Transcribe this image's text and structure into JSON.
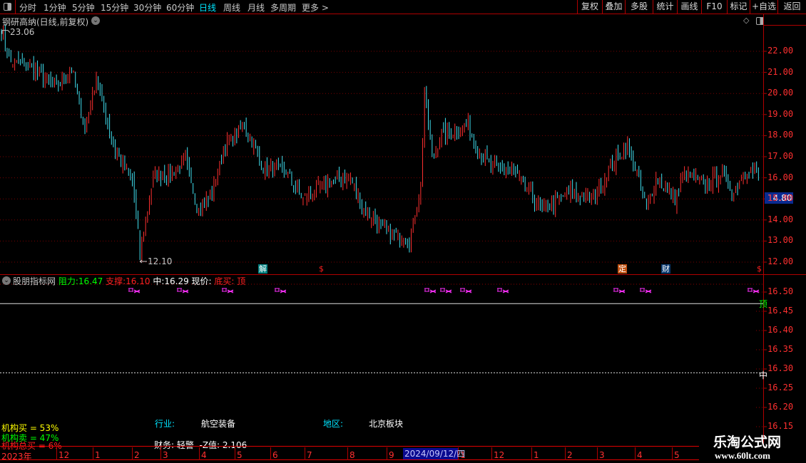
{
  "toolbar": {
    "periods": [
      "分时",
      "1分钟",
      "5分钟",
      "15分钟",
      "30分钟",
      "60分钟",
      "日线",
      "周线",
      "月线",
      "多周期",
      "更多 >"
    ],
    "active_period": "日线",
    "buttons": [
      "复权",
      "叠加",
      "多股",
      "统计",
      "画线",
      "F10",
      "标记",
      "+自选",
      "返回"
    ]
  },
  "main_chart": {
    "title": "钢研高纳(日线,前复权)",
    "high_label": "23.06",
    "low_label": "12.10",
    "current_price": "14.80",
    "axis_labels": [
      "22.00",
      "21.00",
      "20.00",
      "19.00",
      "18.00",
      "17.00",
      "16.00",
      "15.00",
      "14.00",
      "13.00",
      "12.00"
    ],
    "event_markers": [
      {
        "text": "解",
        "color": "#008080"
      },
      {
        "text": "$",
        "color": "#ff2020"
      },
      {
        "text": "定",
        "color": "#c05010"
      },
      {
        "text": "财",
        "color": "#0a3a70"
      },
      {
        "text": "$",
        "color": "#ff2020"
      }
    ]
  },
  "chart_data": {
    "type": "candlestick",
    "title": "钢研高纳(日线,前复权)",
    "ylim": [
      11.8,
      23.2
    ],
    "bar_count": 400,
    "close_anchors": [
      [
        0,
        23.0
      ],
      [
        5,
        21.5
      ],
      [
        16,
        21.2
      ],
      [
        29,
        20.3
      ],
      [
        37,
        21.2
      ],
      [
        44,
        18.3
      ],
      [
        50,
        20.8
      ],
      [
        59,
        17.5
      ],
      [
        69,
        15.8
      ],
      [
        73,
        12.5
      ],
      [
        80,
        16.0
      ],
      [
        90,
        16.3
      ],
      [
        97,
        16.8
      ],
      [
        103,
        14.7
      ],
      [
        110,
        15.0
      ],
      [
        118,
        17.5
      ],
      [
        128,
        18.5
      ],
      [
        138,
        16.5
      ],
      [
        150,
        16.3
      ],
      [
        159,
        15.0
      ],
      [
        172,
        15.8
      ],
      [
        184,
        16.0
      ],
      [
        191,
        14.5
      ],
      [
        202,
        13.5
      ],
      [
        215,
        13.0
      ],
      [
        221,
        15.5
      ],
      [
        223,
        20.0
      ],
      [
        227,
        17.0
      ],
      [
        232,
        18.0
      ],
      [
        246,
        18.5
      ],
      [
        250,
        17.5
      ],
      [
        259,
        16.5
      ],
      [
        270,
        16.3
      ],
      [
        285,
        14.5
      ],
      [
        300,
        15.3
      ],
      [
        311,
        15.0
      ],
      [
        317,
        15.8
      ],
      [
        325,
        17.0
      ],
      [
        330,
        17.5
      ],
      [
        336,
        16.0
      ],
      [
        340,
        14.5
      ],
      [
        345,
        16.0
      ],
      [
        355,
        15.0
      ],
      [
        360,
        16.2
      ],
      [
        371,
        15.7
      ],
      [
        379,
        16.2
      ],
      [
        386,
        15.3
      ],
      [
        392,
        16.4
      ],
      [
        399,
        16.2
      ]
    ],
    "high": 23.06,
    "low": 12.1
  },
  "indicator": {
    "name": "股朋指标网",
    "resist_label": "阻力:",
    "resist_value": "16.47",
    "support_label": "支撑:",
    "support_value": "16.10",
    "mid_label": "中:",
    "mid_value": "16.29",
    "price_label": "现价:",
    "signal": "底买: 顶",
    "top_tag": "顶",
    "mid_tag": "中",
    "axis_labels": [
      "16.50",
      "16.45",
      "16.40",
      "16.35",
      "16.30",
      "16.25",
      "16.20",
      "16.15"
    ],
    "marker_glyph": "ᴴ⁄⁄",
    "institution": [
      {
        "text": "机构买 = 53%",
        "color": "#ffff00"
      },
      {
        "text": "机构卖 = 47%",
        "color": "#00ff00"
      },
      {
        "text": "机构总买 = 6%",
        "color": "#ff2020"
      }
    ],
    "industry_label": "行业:",
    "industry_value": "航空装备",
    "region_label": "地区:",
    "region_value": "北京板块",
    "finance": "财务: 轻警  -Z值: 2.106"
  },
  "date_axis": {
    "labels": [
      "2023年",
      "12",
      "1",
      "2",
      "3",
      "4",
      "5",
      "6",
      "7",
      "8",
      "9",
      "1",
      "12",
      "1",
      "2",
      "3",
      "4",
      "5"
    ],
    "cursor_date": "2024/09/12/四"
  },
  "watermark": {
    "name": "乐淘公式网",
    "url": "www.60lt.com"
  }
}
